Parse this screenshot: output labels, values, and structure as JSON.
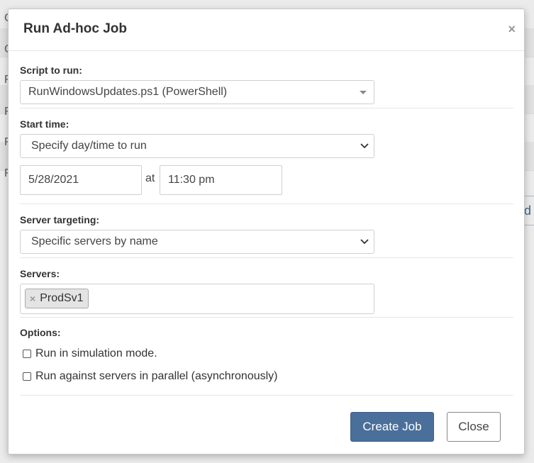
{
  "background": {
    "letters": [
      "C",
      "C",
      "F",
      "F",
      "F",
      "F"
    ],
    "right_button_fragment": "d"
  },
  "modal": {
    "title": "Run Ad-hoc Job",
    "close_glyph": "×"
  },
  "script": {
    "label": "Script to run:",
    "selected": "RunWindowsUpdates.ps1 (PowerShell)"
  },
  "start_time": {
    "label": "Start time:",
    "selected": "Specify day/time to run",
    "date": "5/28/2021",
    "at_label": "at",
    "time": "11:30 pm"
  },
  "server_targeting": {
    "label": "Server targeting:",
    "selected": "Specific servers by name"
  },
  "servers": {
    "label": "Servers:",
    "tags": [
      {
        "remove_glyph": "×",
        "name": "ProdSv1"
      }
    ]
  },
  "options": {
    "label": "Options:",
    "items": [
      {
        "label": "Run in simulation mode."
      },
      {
        "label": "Run against servers in parallel (asynchronously)"
      }
    ]
  },
  "buttons": {
    "create": "Create Job",
    "close": "Close"
  },
  "colors": {
    "primary": "#4a6f9a",
    "border": "#cfcfcf"
  }
}
